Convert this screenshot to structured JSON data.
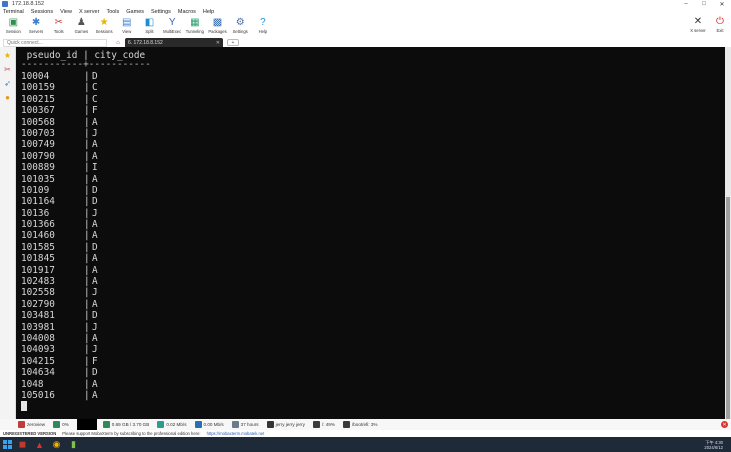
{
  "window": {
    "title": "172.18.8.152"
  },
  "menu": [
    "Terminal",
    "Sessions",
    "View",
    "X server",
    "Tools",
    "Games",
    "Settings",
    "Macros",
    "Help"
  ],
  "toolbar": [
    {
      "label": "Session",
      "icon": "session-icon",
      "color": "#2f8f4e"
    },
    {
      "label": "Servers",
      "icon": "servers-icon",
      "color": "#3b7fd0"
    },
    {
      "label": "Tools",
      "icon": "tools-icon",
      "color": "#d04040"
    },
    {
      "label": "Games",
      "icon": "games-icon",
      "color": "#555555"
    },
    {
      "label": "Sessions",
      "icon": "star-icon",
      "color": "#e8b400"
    },
    {
      "label": "View",
      "icon": "view-icon",
      "color": "#3b7fd0"
    },
    {
      "label": "Split",
      "icon": "split-icon",
      "color": "#1c8fd4"
    },
    {
      "label": "MultiExec",
      "icon": "multiexec-icon",
      "color": "#3f5db8"
    },
    {
      "label": "Tunneling",
      "icon": "tunneling-icon",
      "color": "#2a9d6e"
    },
    {
      "label": "Packages",
      "icon": "packages-icon",
      "color": "#3b6fb0"
    },
    {
      "label": "Settings",
      "icon": "gear-icon",
      "color": "#4a6fa5"
    },
    {
      "label": "Help",
      "icon": "help-icon",
      "color": "#1f8fd8"
    }
  ],
  "toolbar_right": [
    {
      "label": "X server",
      "icon": "xserver-icon",
      "color": "#333333"
    },
    {
      "label": "Exit",
      "icon": "exit-icon",
      "color": "#d82020"
    }
  ],
  "quick_connect": {
    "placeholder": "Quick connect..."
  },
  "tab": {
    "title": "6. 172.18.8.152"
  },
  "terminal": {
    "header": " pseudo_id | city_code",
    "separator": "-----------+-----------",
    "rows": [
      {
        "pseudo_id": "10004",
        "city_code": "D"
      },
      {
        "pseudo_id": "100159",
        "city_code": "C"
      },
      {
        "pseudo_id": "100215",
        "city_code": "C"
      },
      {
        "pseudo_id": "100367",
        "city_code": "F"
      },
      {
        "pseudo_id": "100568",
        "city_code": "A"
      },
      {
        "pseudo_id": "100703",
        "city_code": "J"
      },
      {
        "pseudo_id": "100749",
        "city_code": "A"
      },
      {
        "pseudo_id": "100790",
        "city_code": "A"
      },
      {
        "pseudo_id": "100889",
        "city_code": "I"
      },
      {
        "pseudo_id": "101035",
        "city_code": "A"
      },
      {
        "pseudo_id": "10109",
        "city_code": "D"
      },
      {
        "pseudo_id": "101164",
        "city_code": "D"
      },
      {
        "pseudo_id": "10136",
        "city_code": "J"
      },
      {
        "pseudo_id": "101366",
        "city_code": "A"
      },
      {
        "pseudo_id": "101460",
        "city_code": "A"
      },
      {
        "pseudo_id": "101585",
        "city_code": "D"
      },
      {
        "pseudo_id": "101845",
        "city_code": "A"
      },
      {
        "pseudo_id": "101917",
        "city_code": "A"
      },
      {
        "pseudo_id": "102483",
        "city_code": "A"
      },
      {
        "pseudo_id": "102558",
        "city_code": "J"
      },
      {
        "pseudo_id": "102790",
        "city_code": "A"
      },
      {
        "pseudo_id": "103481",
        "city_code": "D"
      },
      {
        "pseudo_id": "103981",
        "city_code": "J"
      },
      {
        "pseudo_id": "104008",
        "city_code": "A"
      },
      {
        "pseudo_id": "104093",
        "city_code": "J"
      },
      {
        "pseudo_id": "104215",
        "city_code": "F"
      },
      {
        "pseudo_id": "104634",
        "city_code": "D"
      },
      {
        "pseudo_id": "1048",
        "city_code": "A"
      },
      {
        "pseudo_id": "105016",
        "city_code": "A"
      }
    ],
    "colors": {
      "background": "#0c0c0c",
      "text": "#d6d6d6"
    }
  },
  "statusbar": {
    "host": "zeroview",
    "cpu": "0%",
    "memory": "0.69 GB / 3.70 GB",
    "upload": "0.02 Mb/s",
    "download": "0.00 Mb/s",
    "uptime": "37 hours",
    "user": "jerry  jerry  jerry",
    "disk1": "/: 49%",
    "disk2": "/boot/efi: 3%"
  },
  "promo": {
    "unregistered": "UNREGISTERED VERSION",
    "message": "Please support MobaXterm by subscribing to the professional edition here:",
    "link": "https://mobaxterm.mobatek.net"
  },
  "taskbar": {
    "time": "下午 4:30",
    "date": "2024/6/12"
  }
}
